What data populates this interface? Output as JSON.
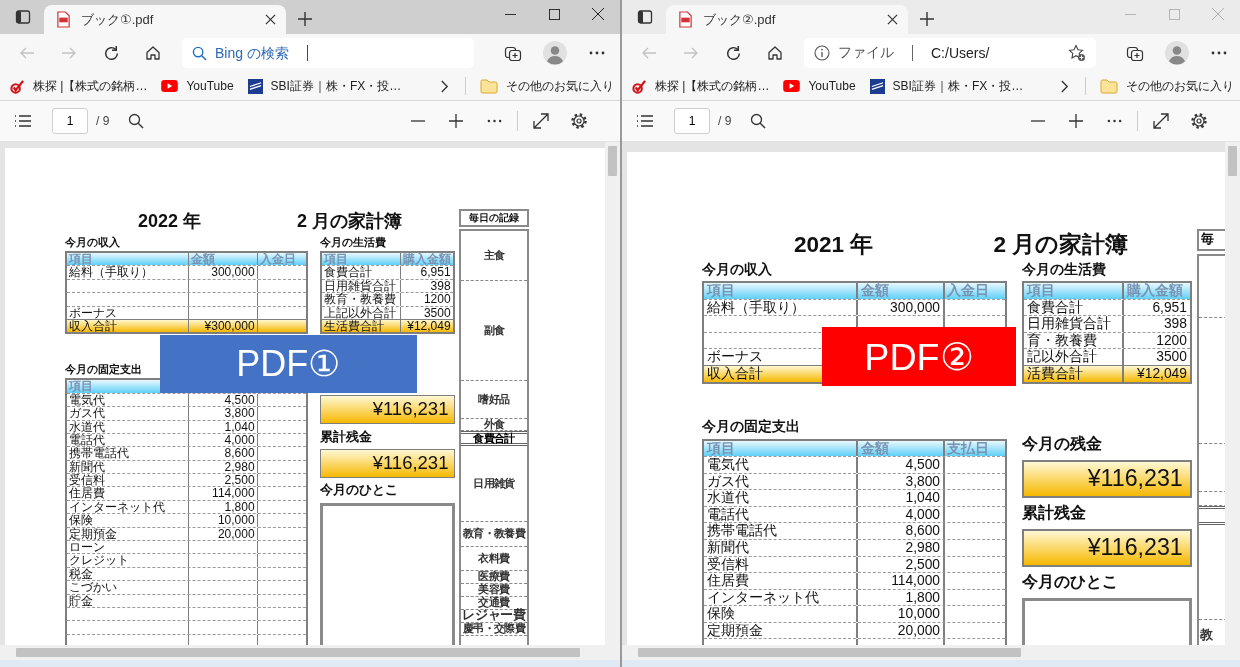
{
  "windows": [
    {
      "active": true,
      "tab": {
        "title": "ブック①.pdf"
      },
      "address": {
        "kind": "search",
        "placeholder": "Bing の検索"
      },
      "favorites": [
        {
          "kind": "kabutan",
          "label": "株探 |【株式の銘柄…"
        },
        {
          "kind": "youtube",
          "label": "YouTube"
        },
        {
          "kind": "sbi",
          "label": "SBI証券｜株・FX・投…"
        }
      ],
      "other_favorites": "その他のお気に入り",
      "pdf_toolbar": {
        "page": "1",
        "total": "/ 9"
      },
      "sheet": {
        "year": "2022 年",
        "month": "2 月の家計簿",
        "income": {
          "title": "今月の収入",
          "columns": [
            "項目",
            "金額",
            "入金日"
          ],
          "rows": [
            {
              "item": "給料（手取り）",
              "amount": "300,000"
            },
            {},
            {},
            {
              "item": "ボーナス"
            },
            {
              "kind": "total",
              "item": "収入合計",
              "amount": "¥300,000"
            }
          ]
        },
        "fixed": {
          "title": "今月の固定支出",
          "columns": [
            "項目"
          ],
          "rows": [
            {
              "item": "電気代",
              "amount": "4,500"
            },
            {
              "item": "ガス代",
              "amount": "3,800"
            },
            {
              "item": "水道代",
              "amount": "1,040"
            },
            {
              "item": "電話代",
              "amount": "4,000"
            },
            {
              "item": "携帯電話代",
              "amount": "8,600"
            },
            {
              "item": "新聞代",
              "amount": "2,980"
            },
            {
              "item": "受信料",
              "amount": "2,500"
            },
            {
              "item": "住居費",
              "amount": "114,000"
            },
            {
              "item": "インターネット代",
              "amount": "1,800"
            },
            {
              "item": "保険",
              "amount": "10,000"
            },
            {
              "item": "定期預金",
              "amount": "20,000"
            },
            {
              "item": "ローン"
            },
            {
              "item": "クレジット"
            },
            {
              "item": "税金"
            },
            {
              "item": "こづかい"
            },
            {
              "item": "貯金"
            }
          ]
        },
        "living": {
          "title": "今月の生活費",
          "columns": [
            "項目",
            "購入金額"
          ],
          "rows": [
            {
              "item": "食費合計",
              "amount": "6,951"
            },
            {
              "item": "日用雑貨合計",
              "amount": "398"
            },
            {
              "item": "教育・教養費",
              "amount": "1200"
            },
            {
              "item": "上記以外合計",
              "amount": "3500"
            },
            {
              "kind": "total",
              "item": "生活費合計",
              "amount": "¥12,049"
            }
          ]
        },
        "balances": [
          {
            "value": "¥116,231"
          },
          {
            "label": "累計残金",
            "value": "¥116,231"
          }
        ],
        "memo": {
          "title": "今月のひとこ"
        },
        "daily": {
          "title": "毎日の記録",
          "items": [
            {
              "label": "主食"
            },
            {
              "label": "副食"
            },
            {
              "label": "嗜好品"
            },
            {
              "label": "外食"
            },
            {
              "kind": "total",
              "label": "食費合計"
            },
            {
              "label": "日用雑貨"
            },
            {
              "label": "教育・教養費"
            },
            {
              "label": "衣料費"
            },
            {
              "label": "医療費"
            },
            {
              "label": "美容費"
            },
            {
              "label": "交通費"
            },
            {
              "label": "レジャー費"
            },
            {
              "label": "慶弔・交際費"
            }
          ]
        }
      },
      "overlay": {
        "label": "PDF①",
        "color": "#4472c4"
      }
    },
    {
      "active": false,
      "tab": {
        "title": "ブック②.pdf"
      },
      "address": {
        "kind": "file",
        "scheme": "ファイル",
        "value": "C:/Users/"
      },
      "favorites": [
        {
          "kind": "kabutan",
          "label": "株探 |【株式の銘柄…"
        },
        {
          "kind": "youtube",
          "label": "YouTube"
        },
        {
          "kind": "sbi",
          "label": "SBI証券｜株・FX・投…"
        }
      ],
      "other_favorites": "その他のお気に入り",
      "pdf_toolbar": {
        "page": "1",
        "total": "/ 9"
      },
      "sheet": {
        "year": "2021 年",
        "month": "2 月の家計簿",
        "income": {
          "title": "今月の収入",
          "columns": [
            "項目",
            "金額",
            "入金日"
          ],
          "rows": [
            {
              "item": "給料（手取り）",
              "amount": "300,000"
            },
            {},
            {},
            {
              "item": "ボーナス"
            },
            {
              "kind": "total",
              "item": "収入合計"
            }
          ]
        },
        "fixed": {
          "title": "今月の固定支出",
          "columns": [
            "項目",
            "金額",
            "支払日"
          ],
          "rows": [
            {
              "item": "電気代",
              "amount": "4,500"
            },
            {
              "item": "ガス代",
              "amount": "3,800"
            },
            {
              "item": "水道代",
              "amount": "1,040"
            },
            {
              "item": "電話代",
              "amount": "4,000"
            },
            {
              "item": "携帯電話代",
              "amount": "8,600"
            },
            {
              "item": "新聞代",
              "amount": "2,980"
            },
            {
              "item": "受信料",
              "amount": "2,500"
            },
            {
              "item": "住居費",
              "amount": "114,000"
            },
            {
              "item": "インターネット代",
              "amount": "1,800"
            },
            {
              "item": "保険",
              "amount": "10,000"
            },
            {
              "item": "定期預金",
              "amount": "20,000"
            }
          ]
        },
        "living": {
          "title": "今月の生活費",
          "columns": [
            "項目",
            "購入金額"
          ],
          "rows": [
            {
              "item": "食費合計",
              "amount": "6,951"
            },
            {
              "item": "日用雑貨合計",
              "amount": "398"
            },
            {
              "item": "育・教養費",
              "amount": "1200"
            },
            {
              "item": "記以外合計",
              "amount": "3500"
            },
            {
              "kind": "total",
              "item": "活費合計",
              "amount": "¥12,049"
            }
          ]
        },
        "balances": [
          {
            "label": "今月の残金",
            "value": "¥116,231"
          },
          {
            "label": "累計残金",
            "value": "¥116,231"
          }
        ],
        "memo": {
          "title": "今月のひとこ"
        },
        "daily": {
          "title": "毎",
          "items": [
            {
              "kind": "cell"
            },
            {
              "kind": "cell"
            },
            {
              "kind": "cell"
            },
            {
              "kind": "cell"
            },
            {
              "kind": "total"
            },
            {
              "kind": "cell"
            },
            {
              "kind": "cell",
              "label": "教"
            }
          ]
        }
      },
      "overlay": {
        "label": "PDF②",
        "color": "#ff0000"
      }
    }
  ]
}
